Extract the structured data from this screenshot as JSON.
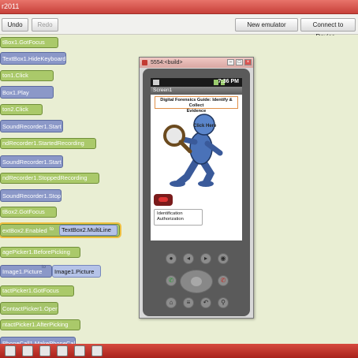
{
  "window": {
    "title": "r2011"
  },
  "toolbar": {
    "undo_label": "Undo",
    "redo_label": "Redo",
    "new_emulator_label": "New emulator",
    "connect_label": "Connect to Device..."
  },
  "blocks": [
    {
      "label": "tBox1.GotFocus"
    },
    {
      "label": "TextBox1.HideKeyboard"
    },
    {
      "label": "ton1.Click"
    },
    {
      "label": "Box1.Play"
    },
    {
      "label": "ton2.Click"
    },
    {
      "label": "SoundRecorder1.Start"
    },
    {
      "label": "ndRecorder1.StartedRecording"
    },
    {
      "label": "SoundRecorder1.Start"
    },
    {
      "label": "ndRecorder1.StoppedRecording"
    },
    {
      "label": "SoundRecorder1.Stop"
    },
    {
      "label": "tBox2.GotFocus"
    },
    {
      "label": "extBox2.Enabled",
      "to": "to",
      "value": "TextBox2.MultiLine"
    },
    {
      "label": "agePicker1.BeforePicking"
    },
    {
      "label": "Image1.Picture",
      "to": "to",
      "value": "Image1.Picture"
    },
    {
      "label": "tactPicker1.GotFocus"
    },
    {
      "label": "ContactPicker1.Open"
    },
    {
      "label": "ntactPicker1.AfterPicking"
    },
    {
      "label": "PhoneCall1.MakePhoneCall"
    }
  ],
  "emulator": {
    "title": "5554:<build>",
    "time": "7:36 PM",
    "screen_title": "Screen1",
    "banner_line1": "Digital Forensics Guide: Identify & Collect",
    "banner_line2": "Evidence",
    "click_here": "Click Here",
    "id_line1": "Identification",
    "id_line2": "Authorization"
  }
}
